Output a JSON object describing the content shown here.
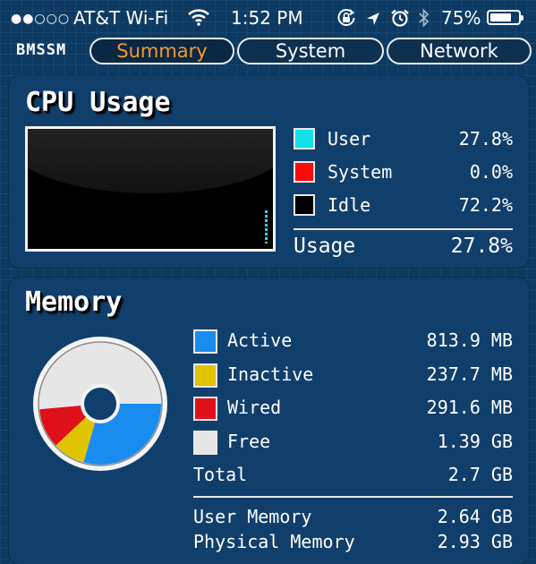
{
  "status_bar": {
    "signal": "●●○○○",
    "carrier": "AT&T Wi-Fi",
    "time": "1:52 PM",
    "battery_pct": "75%",
    "battery_level": 0.75
  },
  "app": {
    "name": "BMSSM"
  },
  "tabs": [
    {
      "label": "Summary",
      "active": true
    },
    {
      "label": "System",
      "active": false
    },
    {
      "label": "Network",
      "active": false
    }
  ],
  "cpu": {
    "title": "CPU Usage",
    "items": [
      {
        "label": "User",
        "value": "27.8%",
        "color": "#12e0e8"
      },
      {
        "label": "System",
        "value": "0.0%",
        "color": "#ff0a0a"
      },
      {
        "label": "Idle",
        "value": "72.2%",
        "color": "#000000"
      }
    ],
    "usage_label": "Usage",
    "usage_value": "27.8%",
    "graph_bar_fraction": 0.278
  },
  "memory": {
    "title": "Memory",
    "items": [
      {
        "label": "Active",
        "value": "813.9 MB",
        "color": "#1a8cf0"
      },
      {
        "label": "Inactive",
        "value": "237.7 MB",
        "color": "#e0c400"
      },
      {
        "label": "Wired",
        "value": "291.6 MB",
        "color": "#e0101a"
      },
      {
        "label": "Free",
        "value": "1.39 GB",
        "color": "#e6e6e6"
      }
    ],
    "total_label": "Total",
    "total_value": "2.7 GB",
    "user_memory_label": "User Memory",
    "user_memory_value": "2.64 GB",
    "physical_memory_label": "Physical Memory",
    "physical_memory_value": "2.93 GB",
    "pie_mb": [
      813.9,
      237.7,
      291.6,
      1423.4
    ]
  }
}
